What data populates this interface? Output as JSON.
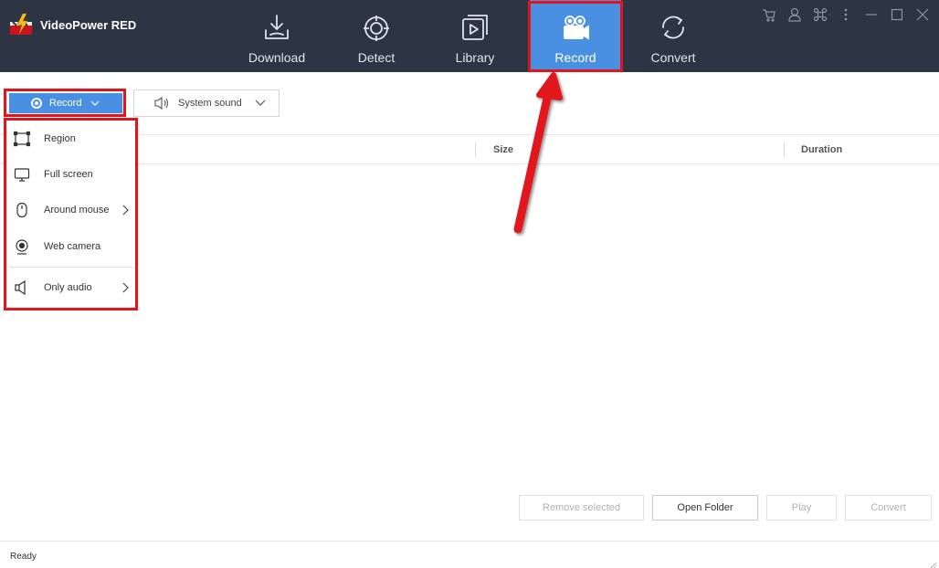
{
  "app": {
    "title": "VideoPower RED"
  },
  "nav": [
    {
      "label": "Download",
      "icon": "download-icon"
    },
    {
      "label": "Detect",
      "icon": "detect-icon"
    },
    {
      "label": "Library",
      "icon": "library-icon"
    },
    {
      "label": "Record",
      "icon": "record-camera-icon",
      "active": true
    },
    {
      "label": "Convert",
      "icon": "convert-icon"
    }
  ],
  "window_controls": [
    "cart-icon",
    "user-icon",
    "command-icon",
    "more-icon",
    "minimize-icon",
    "maximize-icon",
    "close-icon"
  ],
  "toolbar": {
    "record_label": "Record",
    "sound_label": "System sound"
  },
  "record_menu": [
    {
      "label": "Region",
      "icon": "region-icon",
      "submenu": false
    },
    {
      "label": "Full screen",
      "icon": "monitor-icon",
      "submenu": false
    },
    {
      "label": "Around mouse",
      "icon": "mouse-icon",
      "submenu": true
    },
    {
      "label": "Web camera",
      "icon": "webcam-icon",
      "submenu": false
    },
    {
      "label": "Only audio",
      "icon": "speaker-icon",
      "submenu": true
    }
  ],
  "table": {
    "columns": [
      "Size",
      "Duration"
    ]
  },
  "actions": {
    "remove_selected": "Remove selected",
    "open_folder": "Open Folder",
    "play": "Play",
    "convert": "Convert"
  },
  "status": {
    "text": "Ready"
  },
  "colors": {
    "topbar": "#2d3545",
    "accent": "#4a90e2",
    "annotation": "#e3141b"
  }
}
